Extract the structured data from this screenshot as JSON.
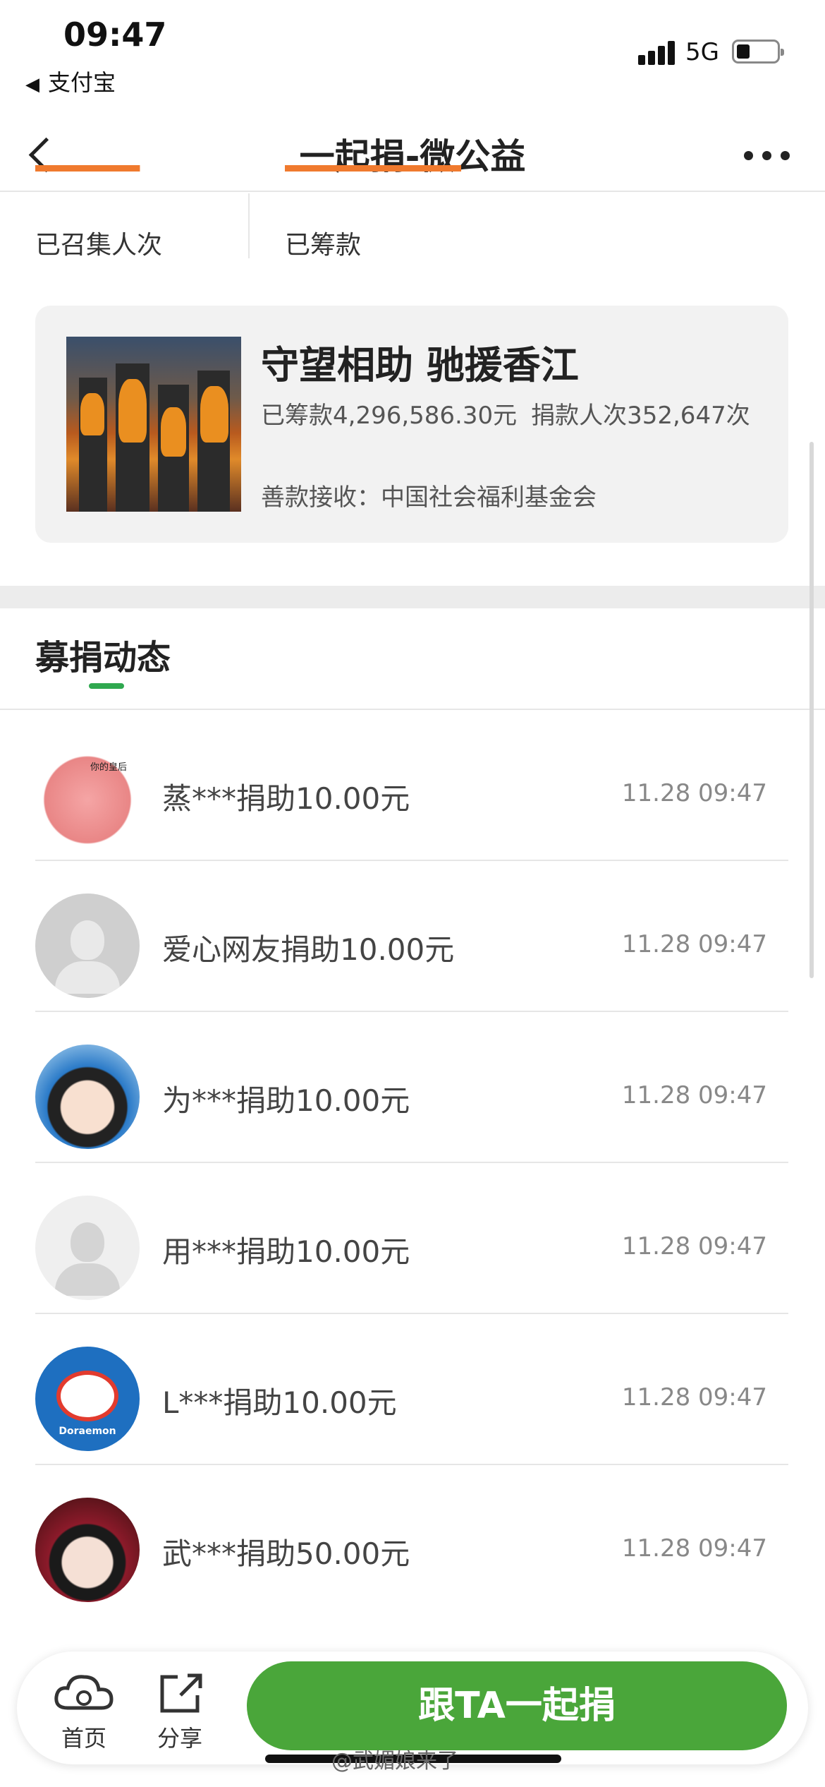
{
  "status": {
    "time": "09:47",
    "back_app": "支付宝",
    "network": "5G"
  },
  "nav": {
    "title": "一起捐-微公益"
  },
  "stats": {
    "people_label": "已召集人次",
    "amount_label": "已筹款"
  },
  "project": {
    "title": "守望相助 驰援香江",
    "raised": "已筹款4,296,586.30元",
    "donors": "捐款人次352,647次",
    "recipient": "善款接收：中国社会福利基金会"
  },
  "tab": {
    "title": "募捐动态"
  },
  "donations": [
    {
      "text": "蒸***捐助10.00元",
      "time": "11.28 09:47",
      "avatar": "cartoon-pig-avatar",
      "badge": "你的皇后"
    },
    {
      "text": "爱心网友捐助10.00元",
      "time": "11.28 09:47",
      "avatar": "default-user-avatar"
    },
    {
      "text": "为***捐助10.00元",
      "time": "11.28 09:47",
      "avatar": "anime-girl-avatar"
    },
    {
      "text": "用***捐助10.00元",
      "time": "11.28 09:47",
      "avatar": "default-user-avatar"
    },
    {
      "text": "L***捐助10.00元",
      "time": "11.28 09:47",
      "avatar": "doraemon-avatar",
      "badge": "Doraemon"
    },
    {
      "text": "武***捐助50.00元",
      "time": "11.28 09:47",
      "avatar": "woman-portrait-avatar"
    }
  ],
  "bottom": {
    "home_label": "首页",
    "share_label": "分享",
    "cta_label": "跟TA一起捐"
  },
  "watermark": "@武媚娘来了",
  "colors": {
    "accent_green": "#4aa63a",
    "tab_underline": "#2fa84f",
    "stat_orange": "#f07a2e"
  }
}
